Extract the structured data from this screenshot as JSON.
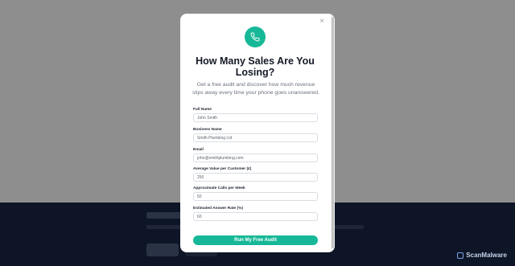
{
  "modal": {
    "title": "How Many Sales Are You Losing?",
    "subtitle": "Get a free audit and discover how much revenue slips away every time your phone goes unanswered.",
    "close_label": "×",
    "icon": "phone-icon",
    "accent_color": "#17b897",
    "fields": [
      {
        "label": "Full Name",
        "value": "John Smith"
      },
      {
        "label": "Business Name",
        "value": "Smith Plumbing Ltd"
      },
      {
        "label": "Email",
        "value": "john@smithplumbing.com"
      },
      {
        "label": "Average Value per Customer (£)",
        "value": "250"
      },
      {
        "label": "Approximate Calls per Week",
        "value": "50"
      },
      {
        "label": "Estimated Answer Rate (%)",
        "value": "60"
      }
    ],
    "submit_label": "Run My Free Audit"
  },
  "watermark": {
    "text": "ScanMalware"
  }
}
